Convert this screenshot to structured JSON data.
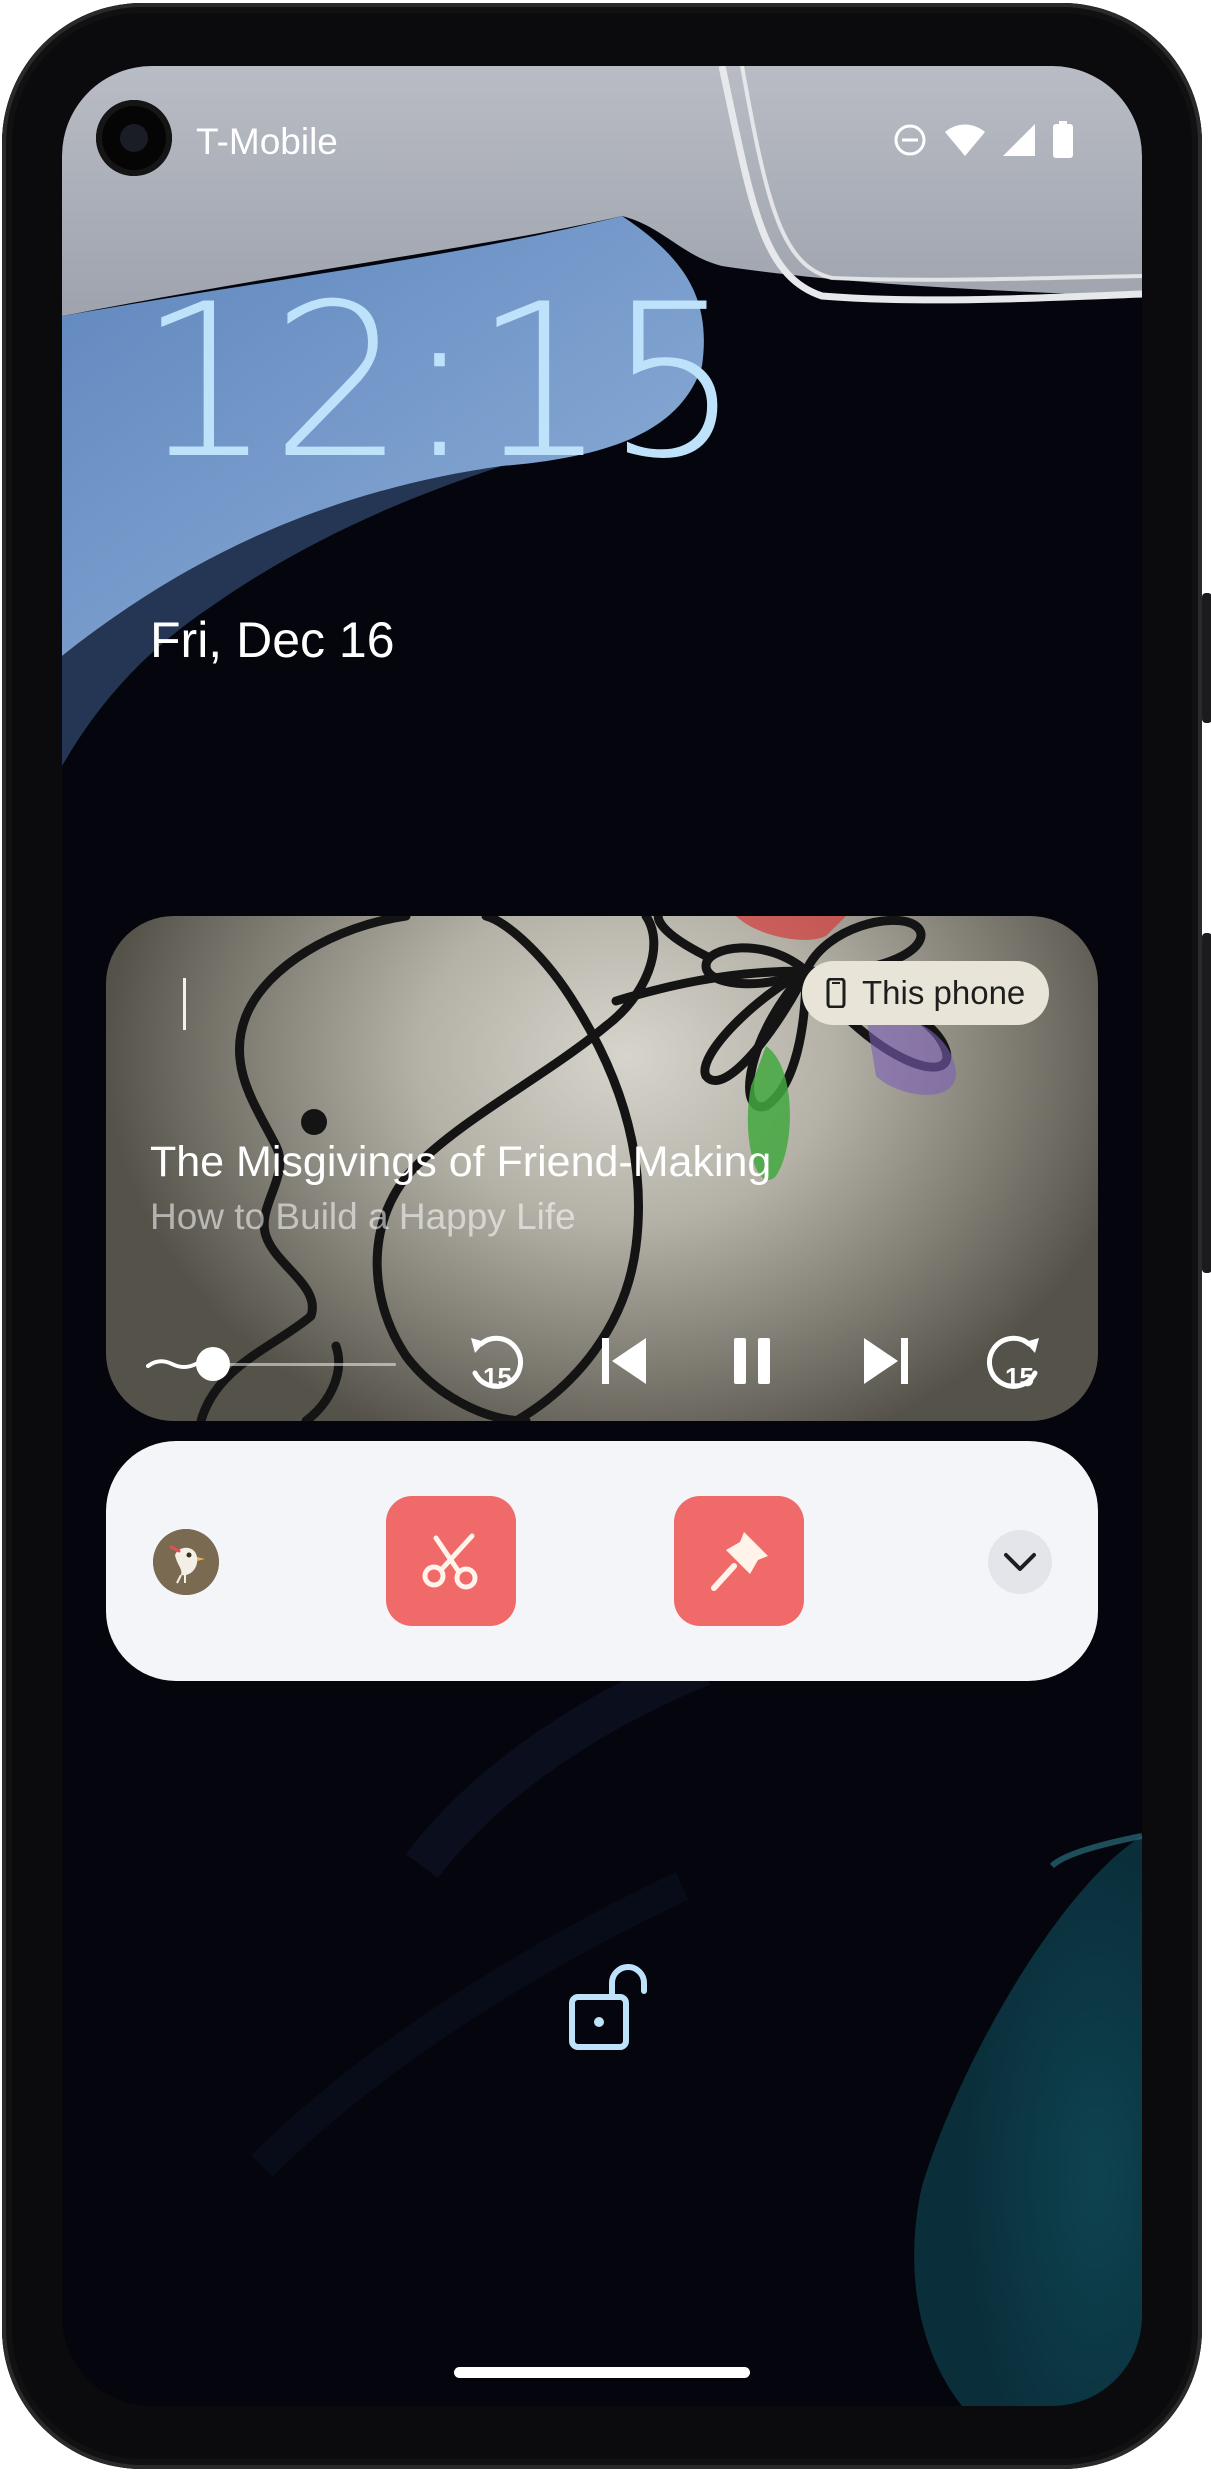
{
  "status_bar": {
    "carrier": "T-Mobile",
    "icons": [
      "camera-cutout",
      "do-not-disturb-icon",
      "wifi-icon",
      "cellular-signal-icon",
      "battery-icon"
    ]
  },
  "lockscreen": {
    "time": "12:15",
    "date": "Fri, Dec 16"
  },
  "media": {
    "output_device": "This phone",
    "output_device_icon": "phone-icon",
    "title": "The Misgivings of Friend-Making",
    "artist": "How to Build a Happy Life",
    "progress_fraction": 0.1,
    "controls": [
      "rewind-15-icon",
      "skip-previous-icon",
      "pause-icon",
      "skip-next-icon",
      "forward-15-icon"
    ],
    "rewind_seconds": "15",
    "forward_seconds": "15"
  },
  "actions": {
    "app_icon": "app-icon",
    "buttons": [
      "scissors-icon",
      "pushpin-icon"
    ],
    "expand_icon": "chevron-down-icon",
    "accent_color": "#f06a6a",
    "icon_color": "#fff3ea"
  },
  "colors": {
    "clock": "#bfe2fb",
    "card_background": "#f4f5f9",
    "screen_background": "#05060d"
  },
  "bottom": {
    "lock_icon": "unlocked-padlock-icon"
  }
}
